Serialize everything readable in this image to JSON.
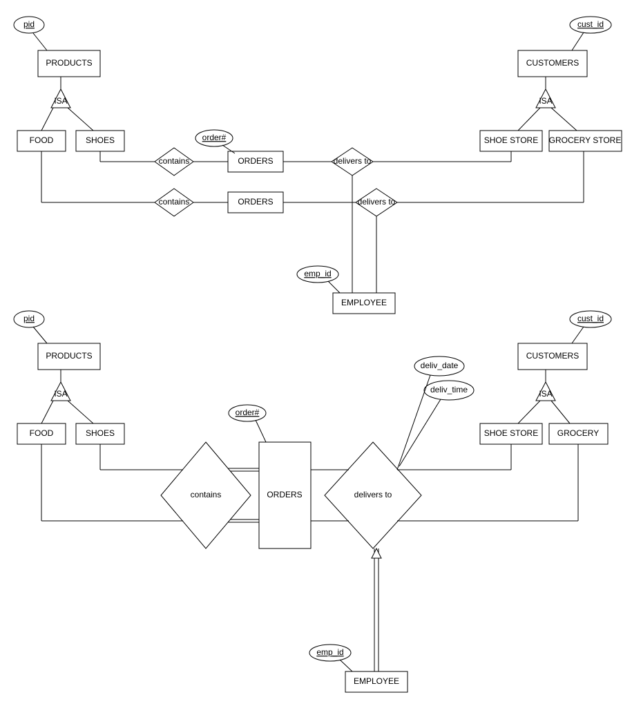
{
  "diagram1": {
    "entities": {
      "products": "PRODUCTS",
      "food": "FOOD",
      "shoes": "SHOES",
      "orders1": "ORDERS",
      "orders2": "ORDERS",
      "employee": "EMPLOYEE",
      "customers": "CUSTOMERS",
      "shoe_store": "SHOE STORE",
      "grocery_store": "GROCERY STORE"
    },
    "relationships": {
      "contains1": "contains",
      "contains2": "contains",
      "delivers1": "delivers to",
      "delivers2": "delivers to"
    },
    "isa": {
      "isa1": "ISA",
      "isa2": "ISA"
    },
    "attributes": {
      "pid": "pid",
      "order_num": "order#",
      "emp_id": "emp_id",
      "cust_id": "cust_id"
    }
  },
  "diagram2": {
    "entities": {
      "products": "PRODUCTS",
      "food": "FOOD",
      "shoes": "SHOES",
      "orders": "ORDERS",
      "employee": "EMPLOYEE",
      "customers": "CUSTOMERS",
      "shoe_store": "SHOE STORE",
      "grocery": "GROCERY"
    },
    "relationships": {
      "contains": "contains",
      "delivers": "delivers to"
    },
    "isa": {
      "isa1": "ISA",
      "isa2": "ISA"
    },
    "attributes": {
      "pid": "pid",
      "order_num": "order#",
      "emp_id": "emp_id",
      "cust_id": "cust_id",
      "deliv_date": "deliv_date",
      "deliv_time": "deliv_time"
    }
  }
}
